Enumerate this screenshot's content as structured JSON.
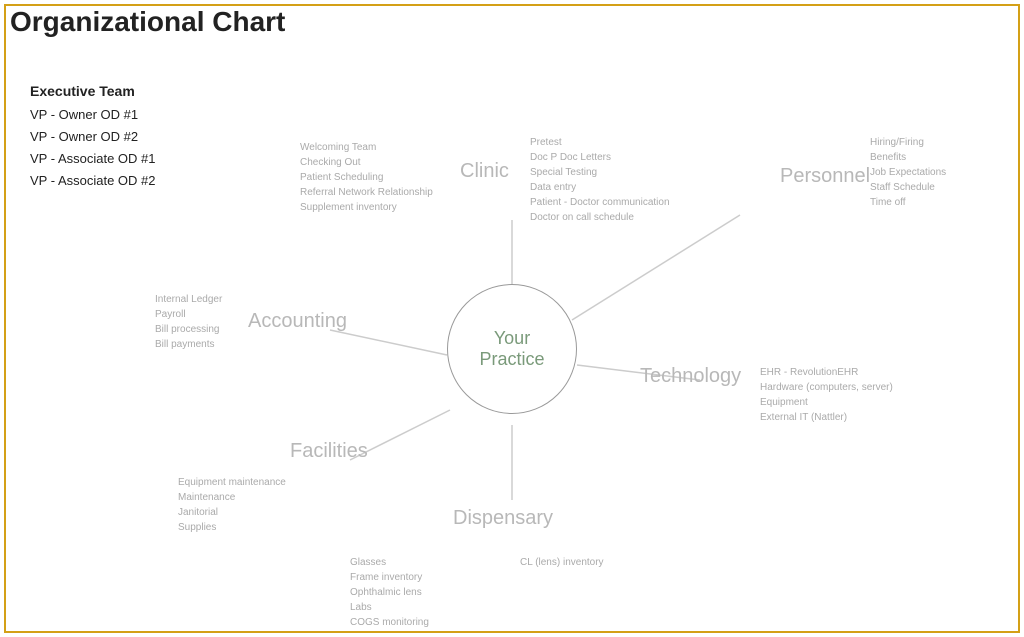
{
  "title": "Organizational Chart",
  "executive": {
    "label": "Executive Team",
    "members": [
      "VP - Owner OD #1",
      "VP - Owner OD #2",
      "VP - Associate OD #1",
      "VP - Associate OD #2"
    ]
  },
  "center": {
    "line1": "Your",
    "line2": "Practice"
  },
  "departments": [
    {
      "name": "Clinic",
      "details": "Pretest\nDoc P Doc Letters\nSpecial Testing\nData entry\nPatient - Doctor communication\nDoctor on call schedule"
    },
    {
      "name": "Personnel",
      "details": "Hiring/Firing\nBenefits\nJob Expectations\nStaff Schedule\nTime off"
    },
    {
      "name": "Accounting",
      "details": "Internal Ledger\nPayroll\nBill processing\nBill payments"
    },
    {
      "name": "Technology",
      "details": "EHR - RevolutionEHR\nHardware (computers, server)\nEquipment\nExternal IT (Nattler)"
    },
    {
      "name": "Facilities",
      "details": "Equipment maintenance\nMaintenance\nJanitorial\nSupplies"
    },
    {
      "name": "Dispensary",
      "details_left": "Glasses\nFrame inventory\nOphthalmic lens\nLabs\nCOGS monitoring",
      "details_right": "CL (lens) inventory"
    }
  ],
  "clinic_small_details": "Welcoming Team\nChecking Out\nPatient Scheduling\nReferral Network Relationship\nSupplement inventory"
}
